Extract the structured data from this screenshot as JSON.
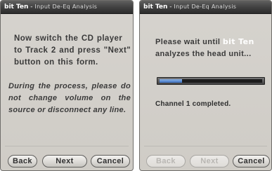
{
  "window": {
    "brand": "bit Ten",
    "separator": " - ",
    "subtitle": "Input De-Eq Analysis"
  },
  "step1": {
    "instruction": "Now switch the CD player to Track 2 and press \"Next\" button on this form.",
    "note": "During the process, please do not change volume on the source or disconnect any line."
  },
  "step2": {
    "wait_before": "Please wait until ",
    "wait_brand": "bit Ten",
    "wait_after": "analyzes the head unit...",
    "progress_fraction": 0.22,
    "status": "Channel 1 completed."
  },
  "buttons": {
    "back": "Back",
    "next": "Next",
    "cancel": "Cancel"
  },
  "colors": {
    "accent_progress": "#3a70c0",
    "titlebar": "#3f3f3f",
    "panel": "#d3d0ca"
  }
}
